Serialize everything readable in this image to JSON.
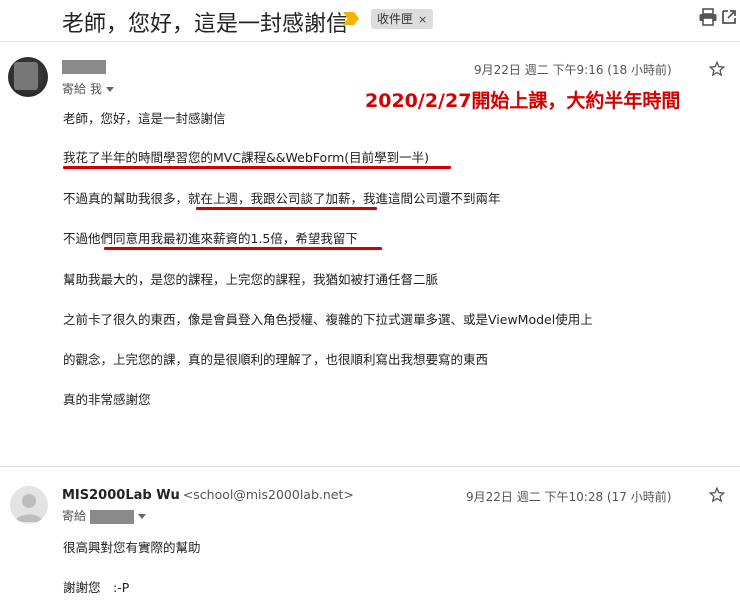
{
  "subject": "老師，您好，這是一封感謝信",
  "label_chip": "收件匣",
  "chip_close": "×",
  "icons": {
    "important": "importance-marker-icon",
    "print": "print-icon",
    "new_window": "open-in-new-window-icon",
    "star": "star-outline-icon",
    "avatar_default": "person-placeholder-icon"
  },
  "colors": {
    "annotation": "#d50000",
    "underline": "#d00000",
    "important_marker": "#f4b400",
    "chip_bg": "#dddddd"
  },
  "message1": {
    "to_label": "寄給 我",
    "date": "9月22日 週二 下午9:16 (18 小時前)",
    "annotation": "2020/2/27開始上課，大約半年時間",
    "lines": [
      "老師，您好，這是一封感謝信",
      "我花了半年的時間學習您的MVC課程&&WebForm(目前學到一半)",
      "不過真的幫助我很多，就在上週，我跟公司談了加薪，我進這間公司還不到兩年",
      "不過他們同意用我最初進來薪資的1.5倍，希望我留下",
      "幫助我最大的，是您的課程，上完您的課程，我猶如被打通任督二脈",
      "之前卡了很久的東西，像是會員登入角色授權、複雜的下拉式選單多選、或是ViewModel使用上",
      "的觀念，上完您的課，真的是很順利的理解了，也很順利寫出我想要寫的東西",
      "真的非常感謝您"
    ]
  },
  "message2": {
    "sender_name": "MIS2000Lab Wu",
    "sender_email": "<school@mis2000lab.net>",
    "to_label": "寄給",
    "date": "9月22日 週二 下午10:28 (17 小時前)",
    "lines": [
      "很高興對您有實際的幫助",
      "謝謝您　:-P"
    ]
  }
}
